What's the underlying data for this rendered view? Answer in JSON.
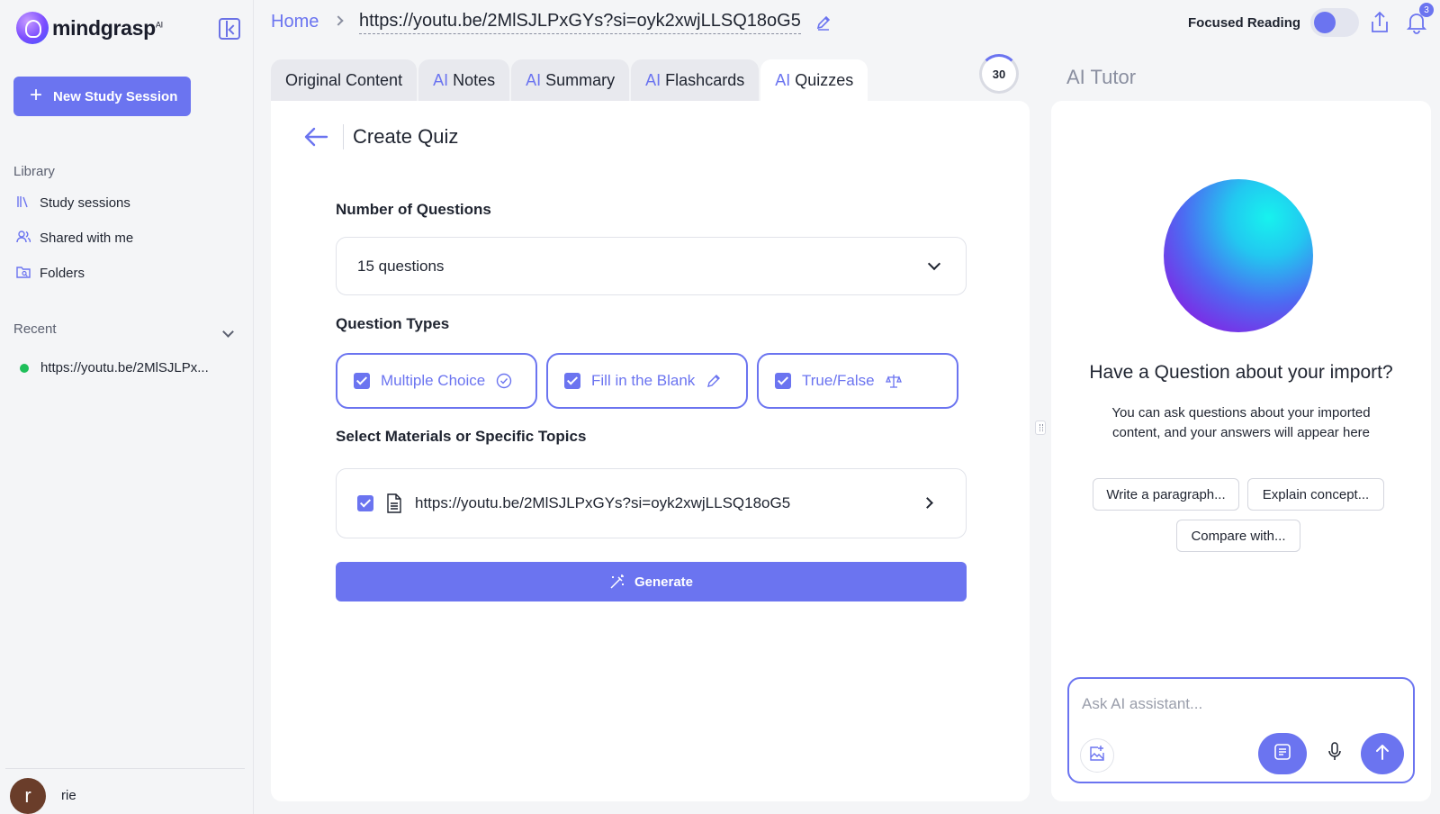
{
  "brand": {
    "name": "mindgrasp",
    "superscript": "AI"
  },
  "sidebar": {
    "new_session_label": "New Study Session",
    "library_label": "Library",
    "library_items": [
      {
        "label": "Study sessions",
        "icon": "books-icon"
      },
      {
        "label": "Shared with me",
        "icon": "users-icon"
      },
      {
        "label": "Folders",
        "icon": "folder-search-icon"
      }
    ],
    "recent_label": "Recent",
    "recent_items": [
      {
        "label": "https://youtu.be/2MlSJLPx..."
      }
    ],
    "user": {
      "initial": "r",
      "name": "rie"
    }
  },
  "header": {
    "home_label": "Home",
    "url": "https://youtu.be/2MlSJLPxGYs?si=oyk2xwjLLSQ18oG5",
    "focused_reading_label": "Focused Reading",
    "focused_reading_on": true,
    "notification_count": "3"
  },
  "tabs": [
    {
      "prefix": "",
      "label": "Original Content",
      "active": false
    },
    {
      "prefix": "AI",
      "label": "Notes",
      "active": false
    },
    {
      "prefix": "AI",
      "label": "Summary",
      "active": false
    },
    {
      "prefix": "AI",
      "label": "Flashcards",
      "active": false
    },
    {
      "prefix": "AI",
      "label": "Quizzes",
      "active": true
    }
  ],
  "counter": "30",
  "quiz": {
    "title": "Create Quiz",
    "num_questions_label": "Number of Questions",
    "num_questions_value": "15 questions",
    "question_types_label": "Question Types",
    "question_types": [
      {
        "label": "Multiple Choice",
        "checked": true,
        "icon": "check-circle-icon"
      },
      {
        "label": "Fill in the Blank",
        "checked": true,
        "icon": "pencil-icon"
      },
      {
        "label": "True/False",
        "checked": true,
        "icon": "scale-icon"
      }
    ],
    "materials_label": "Select Materials or Specific Topics",
    "material_item": "https://youtu.be/2MlSJLPxGYs?si=oyk2xwjLLSQ18oG5",
    "generate_label": "Generate"
  },
  "tutor": {
    "label": "AI Tutor",
    "heading": "Have a Question about your import?",
    "subtext": "You can ask questions about your imported content, and your answers will appear here",
    "suggestions": [
      "Write a paragraph...",
      "Explain concept...",
      "Compare with..."
    ],
    "input_placeholder": "Ask AI assistant..."
  },
  "colors": {
    "accent": "#6b74f0",
    "recent_dot": "#1fbf5a"
  }
}
